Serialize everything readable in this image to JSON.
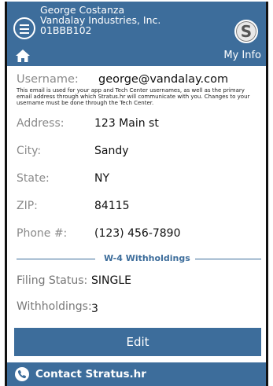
{
  "header": {
    "user_name": "George Costanza",
    "company": "Vandalay Industries, Inc.",
    "employee_id": "01BBB102",
    "logo_letter": "S"
  },
  "nav": {
    "page_title": "My Info"
  },
  "profile": {
    "username_label": "Username:",
    "username_value": "george@vandalay.com",
    "username_note": "This email is used for your app and Tech Center usernames, as well as the primary email address through which Stratus.hr will communicate with you. Changes to your username must be done through the Tech Center.",
    "fields": [
      {
        "label": "Address:",
        "value": "123 Main st"
      },
      {
        "label": "City:",
        "value": "Sandy"
      },
      {
        "label": "State:",
        "value": "NY"
      },
      {
        "label": "ZIP:",
        "value": "84115"
      },
      {
        "label": "Phone #:",
        "value": "(123) 456-7890"
      }
    ]
  },
  "w4": {
    "section_title": "W-4 Withholdings",
    "filing_status_label": "Filing Status:",
    "filing_status_value": "SINGLE",
    "withholdings_label": "Withholdings:",
    "withholdings_value": "3"
  },
  "actions": {
    "edit_label": "Edit"
  },
  "footer": {
    "contact_label": "Contact Stratus.hr"
  },
  "colors": {
    "accent": "#3d6d9b"
  }
}
